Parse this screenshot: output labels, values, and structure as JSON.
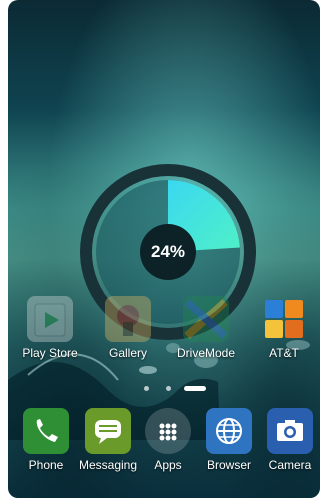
{
  "progress": {
    "label": "24%",
    "value": 0.24
  },
  "colors": {
    "ring_track": "#183238",
    "ring_center": "#0d2226",
    "segment_start": "#3ad8f0",
    "segment_end": "#4ff0c8"
  },
  "home_apps": [
    {
      "label": "Play Store",
      "icon": "play-store-icon"
    },
    {
      "label": "Gallery",
      "icon": "gallery-icon"
    },
    {
      "label": "DriveMode",
      "icon": "drivemode-icon"
    },
    {
      "label": "AT&T",
      "icon": "att-folder-icon"
    }
  ],
  "dock_apps": [
    {
      "label": "Phone",
      "icon": "phone-icon"
    },
    {
      "label": "Messaging",
      "icon": "messaging-icon"
    },
    {
      "label": "Apps",
      "icon": "apps-grid-icon"
    },
    {
      "label": "Browser",
      "icon": "globe-icon"
    },
    {
      "label": "Camera",
      "icon": "camera-icon"
    }
  ],
  "page_indicator": {
    "count": 3,
    "active": 3
  }
}
